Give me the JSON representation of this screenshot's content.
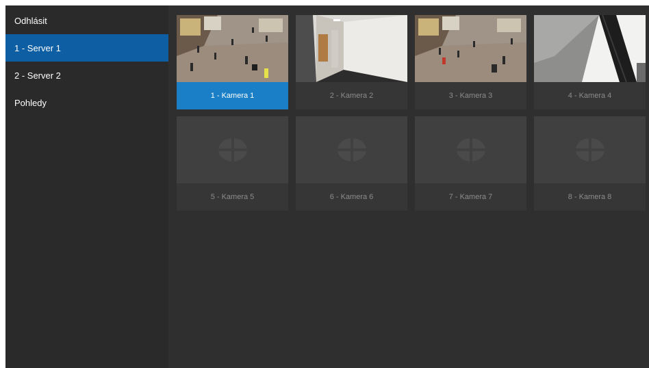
{
  "sidebar": {
    "items": [
      {
        "label": "Odhlásit"
      },
      {
        "label": "1 - Server 1"
      },
      {
        "label": "2 - Server 2"
      },
      {
        "label": "Pohledy"
      }
    ]
  },
  "cameras": [
    {
      "label": "1 - Kamera 1",
      "preview": "street-scene"
    },
    {
      "label": "2 - Kamera 2",
      "preview": "corridor-scene"
    },
    {
      "label": "3 - Kamera 3",
      "preview": "street-scene"
    },
    {
      "label": "4 - Kamera 4",
      "preview": "ceiling-scene"
    },
    {
      "label": "5 - Kamera 5",
      "preview": "camera-placeholder-icon"
    },
    {
      "label": "6 - Kamera 6",
      "preview": "camera-placeholder-icon"
    },
    {
      "label": "7 - Kamera 7",
      "preview": "camera-placeholder-icon"
    },
    {
      "label": "8 - Kamera 8",
      "preview": "camera-placeholder-icon"
    }
  ],
  "colors": {
    "app_bg": "#2f2f2f",
    "sidebar_bg": "#2a2a2a",
    "nav_active": "#0e5ea3",
    "tile_selected": "#1a7fc6"
  }
}
